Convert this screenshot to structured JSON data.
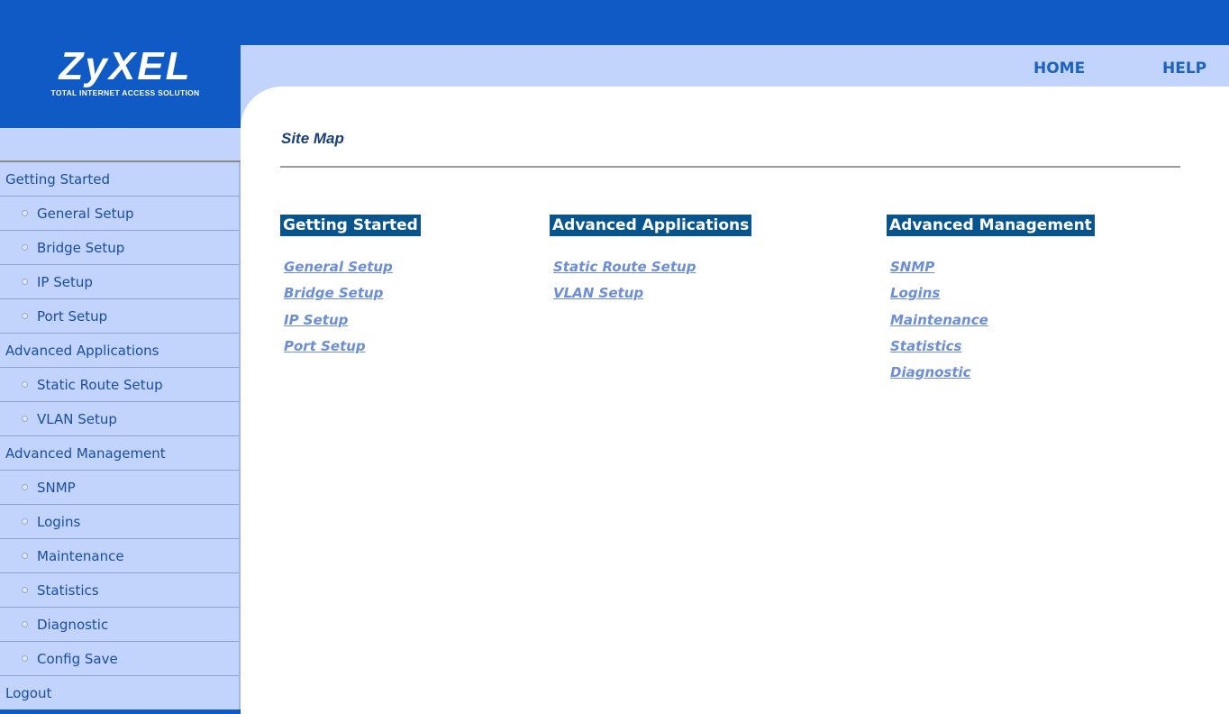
{
  "brand": {
    "logo": "ZyXEL",
    "tagline": "TOTAL INTERNET ACCESS SOLUTION"
  },
  "topnav": {
    "home": "HOME",
    "help": "HELP"
  },
  "sidebar": {
    "items": [
      {
        "label": "Getting Started",
        "type": "section"
      },
      {
        "label": "General Setup",
        "type": "sub"
      },
      {
        "label": "Bridge Setup",
        "type": "sub"
      },
      {
        "label": "IP Setup",
        "type": "sub"
      },
      {
        "label": "Port Setup",
        "type": "sub"
      },
      {
        "label": "Advanced Applications",
        "type": "section"
      },
      {
        "label": "Static Route Setup",
        "type": "sub"
      },
      {
        "label": "VLAN Setup",
        "type": "sub"
      },
      {
        "label": "Advanced Management",
        "type": "section"
      },
      {
        "label": "SNMP",
        "type": "sub"
      },
      {
        "label": "Logins",
        "type": "sub"
      },
      {
        "label": "Maintenance",
        "type": "sub"
      },
      {
        "label": "Statistics",
        "type": "sub"
      },
      {
        "label": "Diagnostic",
        "type": "sub"
      },
      {
        "label": "Config Save",
        "type": "sub"
      },
      {
        "label": "Logout",
        "type": "section"
      }
    ]
  },
  "main": {
    "title": "Site Map",
    "columns": [
      {
        "heading": "Getting Started",
        "links": [
          "General Setup",
          "Bridge Setup",
          "IP Setup",
          "Port Setup"
        ]
      },
      {
        "heading": "Advanced Applications",
        "links": [
          "Static Route Setup",
          "VLAN Setup"
        ]
      },
      {
        "heading": "Advanced Management",
        "links": [
          "SNMP",
          "Logins",
          "Maintenance",
          "Statistics",
          "Diagnostic"
        ]
      }
    ]
  },
  "colors": {
    "brand_blue": "#0f5ac4",
    "sidebar_bg": "#c2d4fb",
    "heading_bg": "#08548c",
    "link_color": "#6b8ed6"
  }
}
